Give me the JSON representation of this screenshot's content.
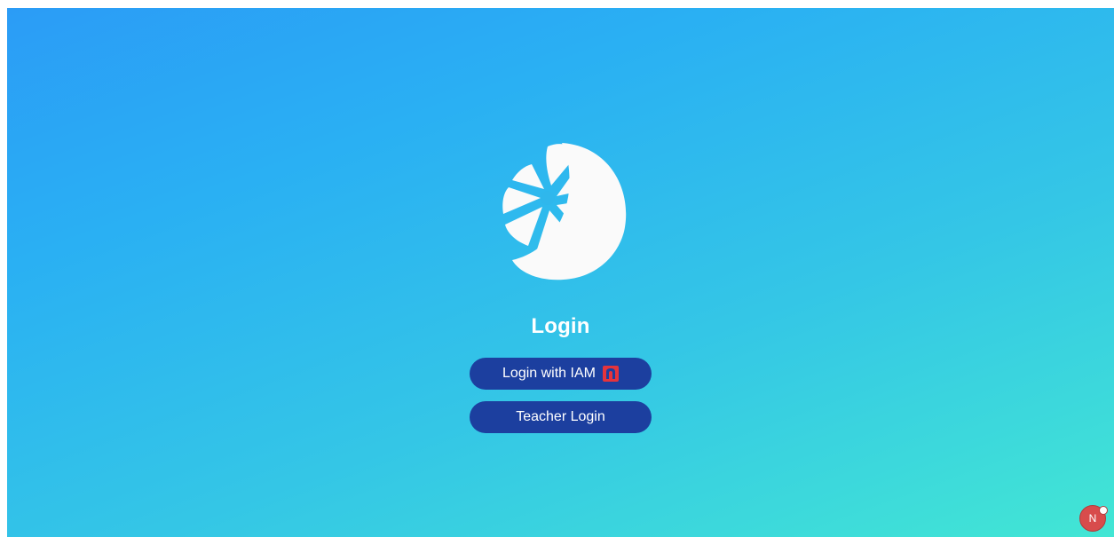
{
  "login": {
    "title": "Login",
    "iam_button_label": "Login with IAM",
    "teacher_button_label": "Teacher Login"
  },
  "badge": {
    "label": "N"
  },
  "icons": {
    "logo": "lemon-slice-logo",
    "iam": "iam-shield-icon",
    "badge": "next-dev-badge"
  },
  "colors": {
    "gradient_start": "#2b9cf6",
    "gradient_end": "#42e6d4",
    "button_bg": "#1c3f9f",
    "iam_icon": "#e5343c",
    "badge_bg": "#d84c4c"
  }
}
